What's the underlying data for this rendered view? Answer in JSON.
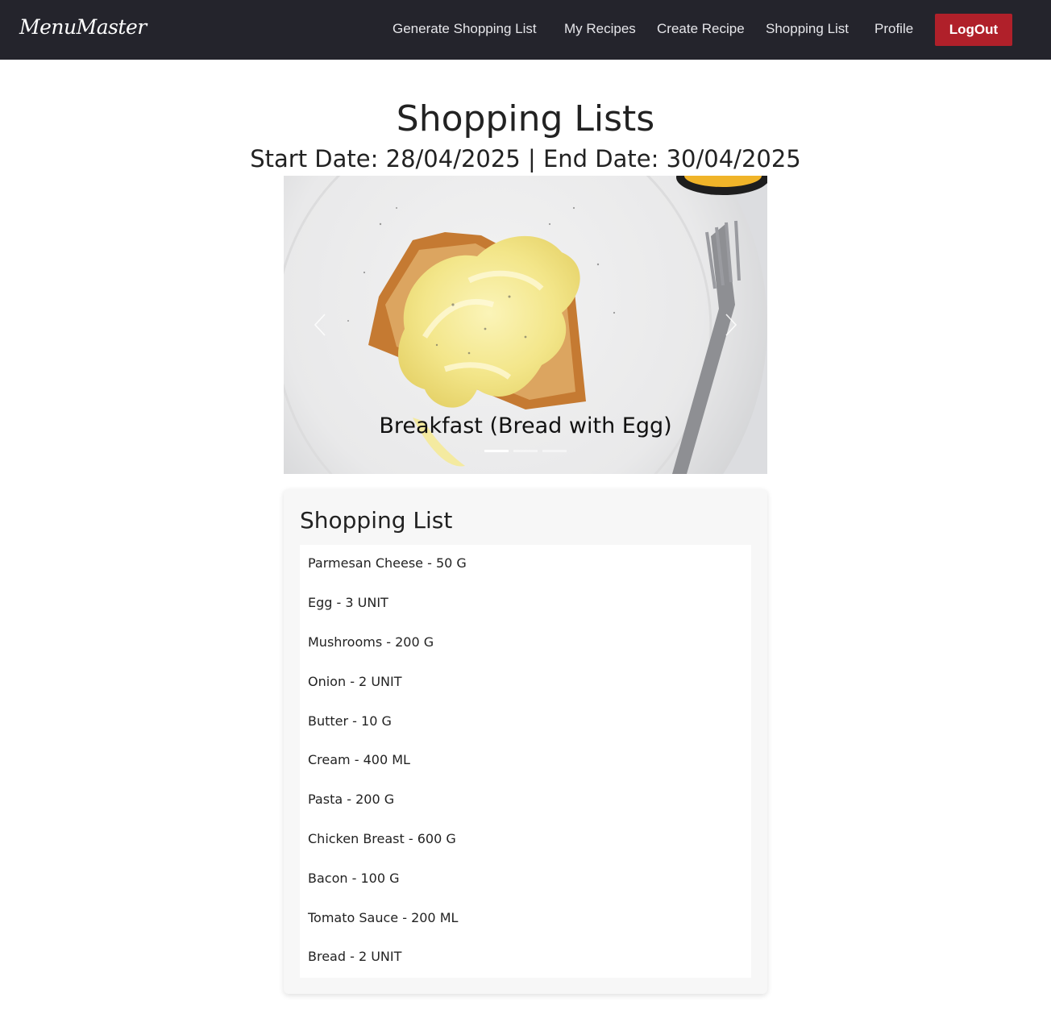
{
  "navbar": {
    "brand": "MenuMaster",
    "links": [
      {
        "label": "Generate Shopping List"
      },
      {
        "label": "My Recipes"
      },
      {
        "label": "Create Recipe"
      },
      {
        "label": "Shopping List"
      },
      {
        "label": "Profile"
      }
    ],
    "logout_label": "LogOut",
    "background_color": "#24242c",
    "logout_color": "#b0202a"
  },
  "page": {
    "title": "Shopping Lists",
    "date_line": "Start Date: 28/04/2025 | End Date: 30/04/2025"
  },
  "carousel": {
    "caption": "Breakfast (Bread with Egg)",
    "slide_count": 3,
    "active_slide": 1,
    "prev_icon": "chevron-left-icon",
    "next_icon": "chevron-right-icon"
  },
  "shopping_list": {
    "title": "Shopping List",
    "items": [
      "Parmesan Cheese - 50 G",
      "Egg - 3 UNIT",
      "Mushrooms - 200 G",
      "Onion - 2 UNIT",
      "Butter - 10 G",
      "Cream - 400 ML",
      "Pasta - 200 G",
      "Chicken Breast - 600 G",
      "Bacon - 100 G",
      "Tomato Sauce - 200 ML",
      "Bread - 2 UNIT"
    ]
  }
}
